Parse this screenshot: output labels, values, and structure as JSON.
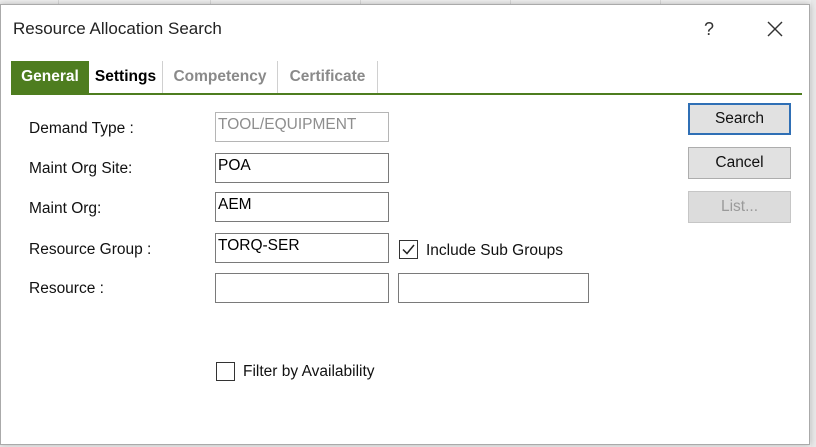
{
  "dialog": {
    "title": "Resource Allocation Search",
    "help_glyph": "?",
    "close_icon": "close-icon"
  },
  "tabs": [
    {
      "label": "General",
      "active": true
    },
    {
      "label": "Settings",
      "active": false
    },
    {
      "label": "Competency",
      "active": false,
      "disabled": true
    },
    {
      "label": "Certificate",
      "active": false,
      "disabled": true
    }
  ],
  "form": {
    "demand_type": {
      "label": "Demand Type :",
      "value": "TOOL/EQUIPMENT",
      "disabled": true
    },
    "maint_org_site": {
      "label": "Maint Org Site:",
      "value": "POA"
    },
    "maint_org": {
      "label": "Maint Org:",
      "value": "AEM"
    },
    "resource_group": {
      "label": "Resource Group :",
      "value": "TORQ-SER"
    },
    "include_sub_groups": {
      "label": "Include Sub Groups",
      "checked": true
    },
    "resource": {
      "label": "Resource :",
      "value": "",
      "description": ""
    },
    "filter_by_availability": {
      "label": "Filter by Availability",
      "checked": false
    }
  },
  "buttons": {
    "search": "Search",
    "cancel": "Cancel",
    "list": "List..."
  },
  "colors": {
    "accent_green": "#4e7d1f",
    "default_button_border": "#2f6fb5"
  }
}
